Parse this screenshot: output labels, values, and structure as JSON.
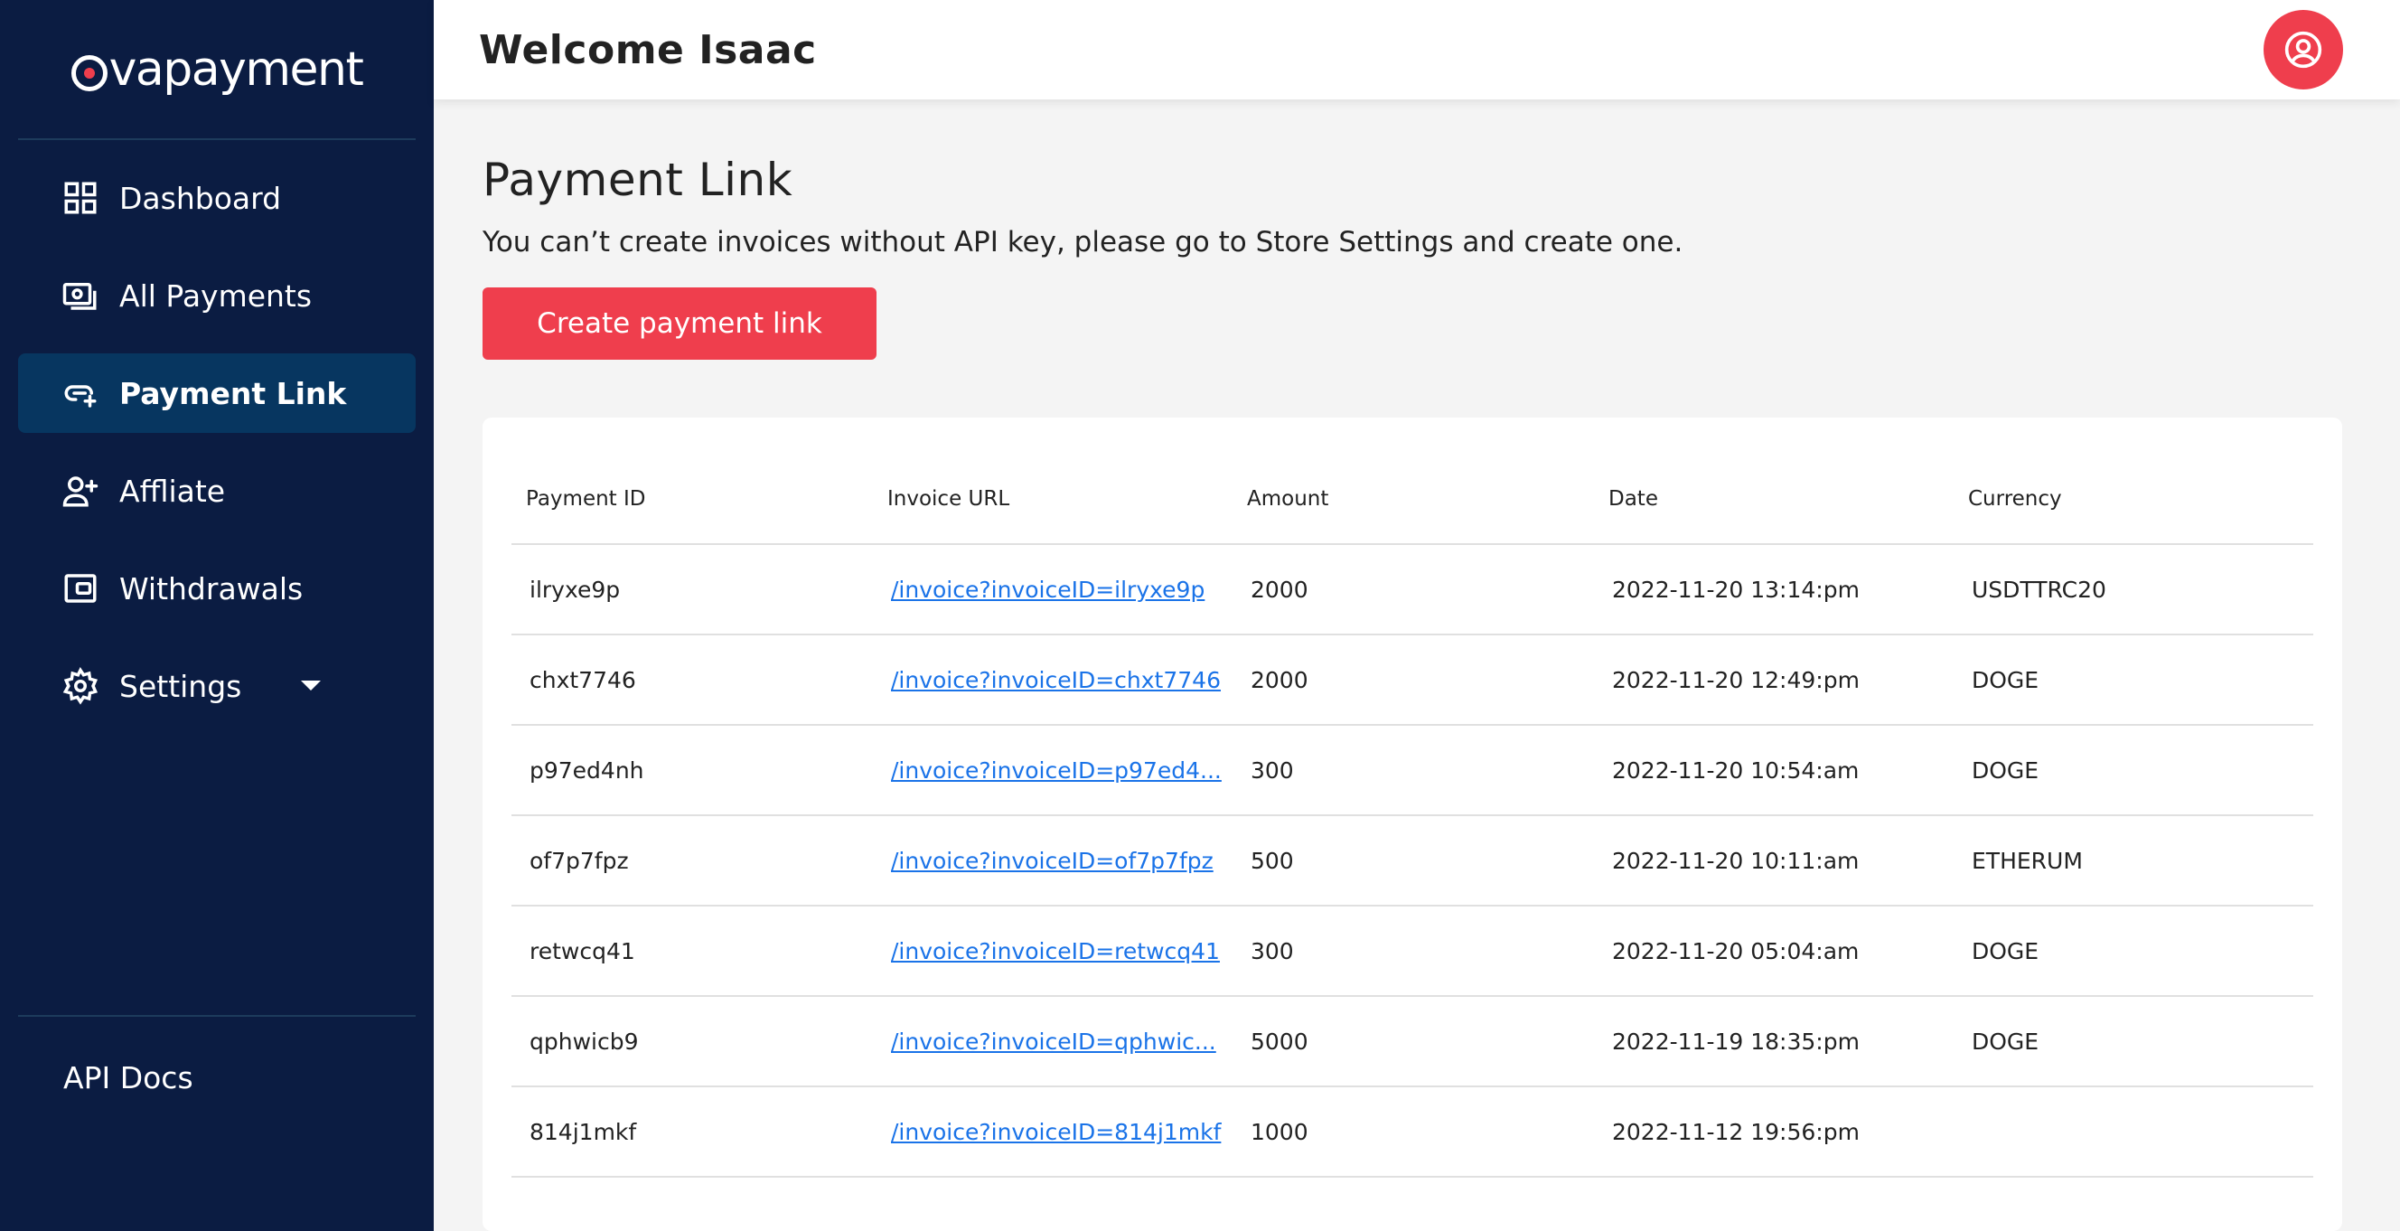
{
  "brand": {
    "name": "evapayment",
    "logo_text_tail": "vapayment",
    "accent": "#ef3e4d",
    "sidebar_bg": "#0b1c42"
  },
  "sidebar": {
    "items": [
      {
        "label": "Dashboard",
        "icon": "grid-icon"
      },
      {
        "label": "All Payments",
        "icon": "cash-icon"
      },
      {
        "label": "Payment Link",
        "icon": "link-add-icon",
        "active": true
      },
      {
        "label": "Affliate",
        "icon": "user-add-icon"
      },
      {
        "label": "Withdrawals",
        "icon": "wallet-icon"
      },
      {
        "label": "Settings",
        "icon": "gear-icon",
        "has_dropdown": true
      }
    ],
    "bottom": {
      "api_docs": "API Docs"
    }
  },
  "header": {
    "welcome": "Welcome Isaac",
    "avatar_icon": "user-circle-icon"
  },
  "main": {
    "title": "Payment Link",
    "notice": "You can’t create invoices without API key, please go to Store Settings and create one.",
    "create_button": "Create payment link",
    "table": {
      "headers": [
        "Payment ID",
        "Invoice URL",
        "Amount",
        "Date",
        "Currency"
      ],
      "rows": [
        {
          "id": "ilryxe9p",
          "url": "/invoice?invoiceID=ilryxe9p",
          "amount": "2000",
          "date": "2022-11-20 13:14:pm",
          "currency": "USDTTRC20"
        },
        {
          "id": "chxt7746",
          "url": "/invoice?invoiceID=chxt7746",
          "amount": "2000",
          "date": "2022-11-20 12:49:pm",
          "currency": "DOGE"
        },
        {
          "id": "p97ed4nh",
          "url": "/invoice?invoiceID=p97ed4...",
          "amount": "300",
          "date": "2022-11-20 10:54:am",
          "currency": "DOGE"
        },
        {
          "id": "of7p7fpz",
          "url": "/invoice?invoiceID=of7p7fpz",
          "amount": "500",
          "date": "2022-11-20 10:11:am",
          "currency": "ETHERUM"
        },
        {
          "id": "retwcq41",
          "url": "/invoice?invoiceID=retwcq41",
          "amount": "300",
          "date": "2022-11-20 05:04:am",
          "currency": "DOGE"
        },
        {
          "id": "qphwicb9",
          "url": "/invoice?invoiceID=qphwic...",
          "amount": "5000",
          "date": "2022-11-19 18:35:pm",
          "currency": "DOGE"
        },
        {
          "id": "814j1mkf",
          "url": "/invoice?invoiceID=814j1mkf",
          "amount": "1000",
          "date": "2022-11-12 19:56:pm",
          "currency": ""
        }
      ]
    }
  }
}
